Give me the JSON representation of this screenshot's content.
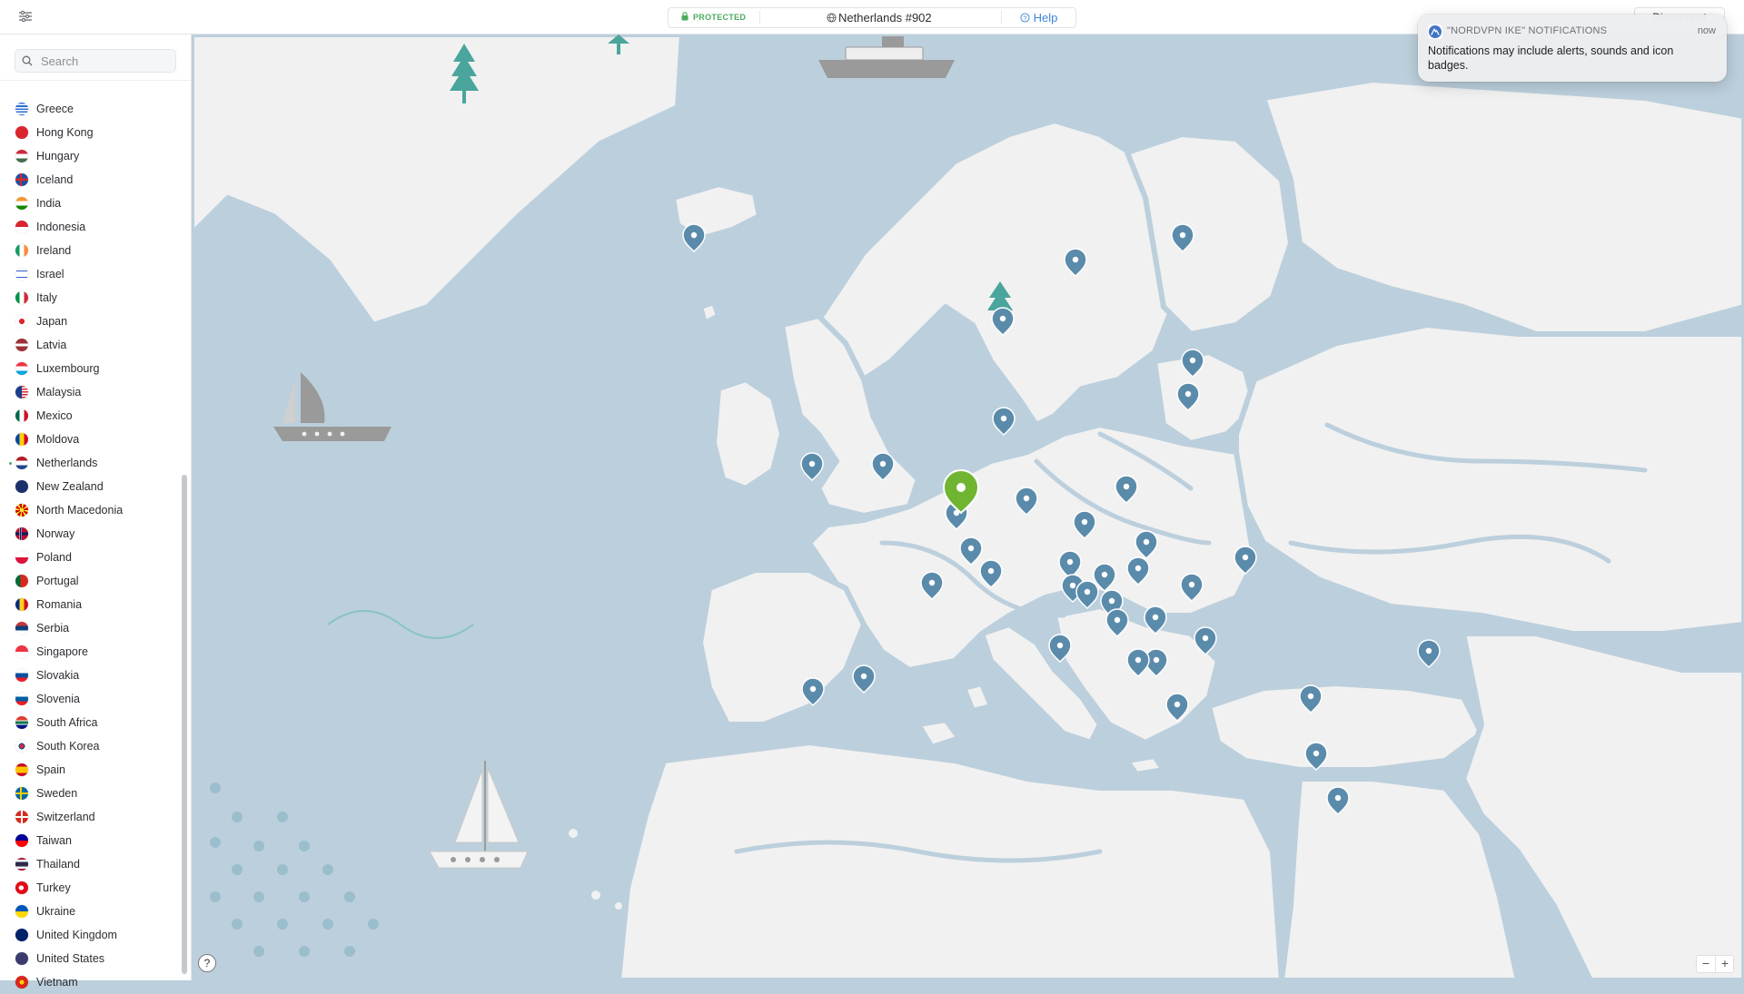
{
  "topbar": {
    "menu_icon": "sliders-menu-icon",
    "status": "PROTECTED",
    "server": "Netherlands #902",
    "help": "Help",
    "disconnect": "Disconnect"
  },
  "sidebar": {
    "search_placeholder": "Search",
    "countries": [
      {
        "name": "Greece",
        "flag": "gr"
      },
      {
        "name": "Hong Kong",
        "flag": "hk"
      },
      {
        "name": "Hungary",
        "flag": "hu"
      },
      {
        "name": "Iceland",
        "flag": "is"
      },
      {
        "name": "India",
        "flag": "in"
      },
      {
        "name": "Indonesia",
        "flag": "id"
      },
      {
        "name": "Ireland",
        "flag": "ie"
      },
      {
        "name": "Israel",
        "flag": "il"
      },
      {
        "name": "Italy",
        "flag": "it"
      },
      {
        "name": "Japan",
        "flag": "jp"
      },
      {
        "name": "Latvia",
        "flag": "lv"
      },
      {
        "name": "Luxembourg",
        "flag": "lu"
      },
      {
        "name": "Malaysia",
        "flag": "my"
      },
      {
        "name": "Mexico",
        "flag": "mx"
      },
      {
        "name": "Moldova",
        "flag": "md"
      },
      {
        "name": "Netherlands",
        "flag": "nl",
        "active": true
      },
      {
        "name": "New Zealand",
        "flag": "nz"
      },
      {
        "name": "North Macedonia",
        "flag": "mk"
      },
      {
        "name": "Norway",
        "flag": "no"
      },
      {
        "name": "Poland",
        "flag": "pl"
      },
      {
        "name": "Portugal",
        "flag": "pt"
      },
      {
        "name": "Romania",
        "flag": "ro"
      },
      {
        "name": "Serbia",
        "flag": "rs"
      },
      {
        "name": "Singapore",
        "flag": "sg"
      },
      {
        "name": "Slovakia",
        "flag": "sk"
      },
      {
        "name": "Slovenia",
        "flag": "si"
      },
      {
        "name": "South Africa",
        "flag": "za"
      },
      {
        "name": "South Korea",
        "flag": "kr"
      },
      {
        "name": "Spain",
        "flag": "es"
      },
      {
        "name": "Sweden",
        "flag": "se"
      },
      {
        "name": "Switzerland",
        "flag": "ch"
      },
      {
        "name": "Taiwan",
        "flag": "tw"
      },
      {
        "name": "Thailand",
        "flag": "th"
      },
      {
        "name": "Turkey",
        "flag": "tr"
      },
      {
        "name": "Ukraine",
        "flag": "ua"
      },
      {
        "name": "United Kingdom",
        "flag": "gb"
      },
      {
        "name": "United States",
        "flag": "us"
      },
      {
        "name": "Vietnam",
        "flag": "vn"
      }
    ]
  },
  "notification": {
    "app": "\"NORDVPN IKE\" NOTIFICATIONS",
    "time": "now",
    "body": "Notifications may include alerts, sounds and icon badges."
  },
  "map": {
    "help_label": "?",
    "zoom_out": "−",
    "zoom_in": "+",
    "colors": {
      "water": "#bccfdc",
      "land": "#f1f1f1",
      "pin": "#5b8bab",
      "active_pin": "#6fb531"
    }
  }
}
